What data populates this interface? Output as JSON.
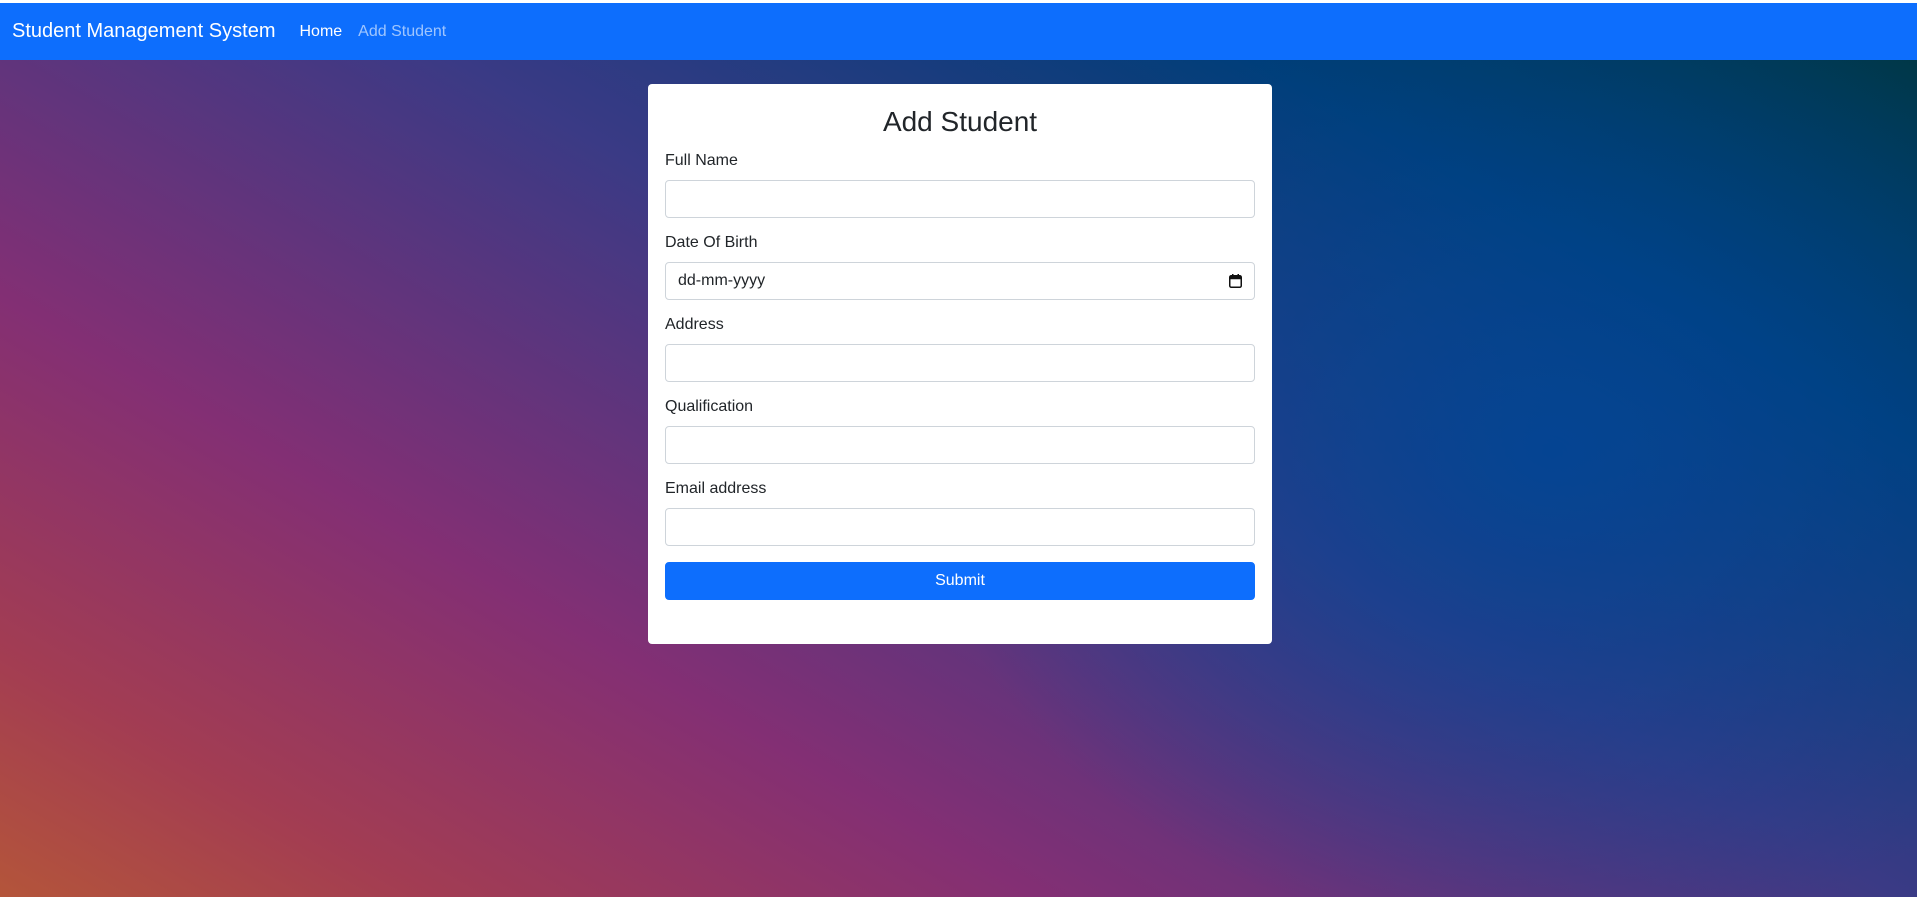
{
  "navbar": {
    "brand": "Student Management System",
    "links": [
      {
        "label": "Home"
      },
      {
        "label": "Add Student"
      }
    ],
    "color": "#0d6efd"
  },
  "form": {
    "title": "Add Student",
    "fields": [
      {
        "label": "Full Name",
        "value": ""
      },
      {
        "label": "Date Of Birth",
        "placeholder": "dd-mm-yyyy",
        "icon": "calendar-icon"
      },
      {
        "label": "Address",
        "value": ""
      },
      {
        "label": "Qualification",
        "value": ""
      },
      {
        "label": "Email address",
        "value": ""
      }
    ],
    "submit_label": "Submit"
  }
}
